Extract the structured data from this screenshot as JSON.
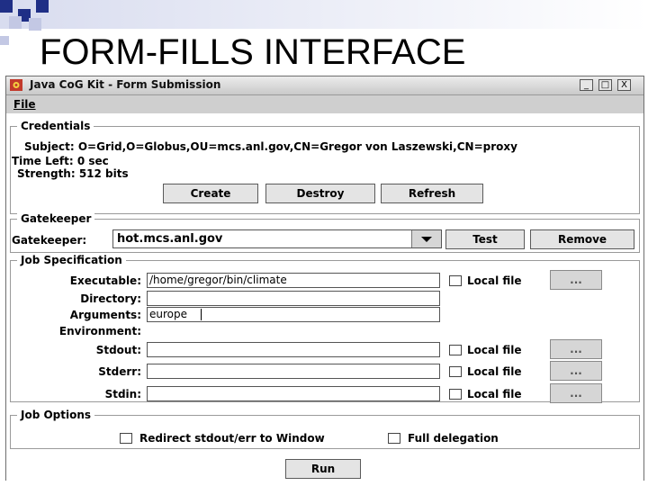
{
  "slide": {
    "title": "FORM-FILLS INTERFACE"
  },
  "window": {
    "title": "Java CoG Kit - Form Submission",
    "menu": {
      "file": "File"
    },
    "controls": {
      "minimize": "_",
      "maximize": "□",
      "close": "X"
    }
  },
  "credentials": {
    "legend": "Credentials",
    "subject": "Subject: O=Grid,O=Globus,OU=mcs.anl.gov,CN=Gregor von Laszewski,CN=proxy",
    "time_left": "Time Left: 0 sec",
    "strength": "Strength: 512 bits",
    "buttons": {
      "create": "Create",
      "destroy": "Destroy",
      "refresh": "Refresh"
    }
  },
  "gatekeeper": {
    "legend": "Gatekeeper",
    "label": "Gatekeeper:",
    "value": "hot.mcs.anl.gov",
    "buttons": {
      "test": "Test",
      "remove": "Remove"
    }
  },
  "job_spec": {
    "legend": "Job Specification",
    "executable": {
      "label": "Executable:",
      "value": "/home/gregor/bin/climate"
    },
    "directory": {
      "label": "Directory:",
      "value": ""
    },
    "arguments": {
      "label": "Arguments:",
      "value": "europe"
    },
    "environment": {
      "label": "Environment:"
    },
    "stdout": {
      "label": "Stdout:",
      "value": ""
    },
    "stderr": {
      "label": "Stderr:",
      "value": ""
    },
    "stdin": {
      "label": "Stdin:",
      "value": ""
    },
    "local_file": "Local file",
    "browse": "..."
  },
  "job_options": {
    "legend": "Job Options",
    "redirect": "Redirect stdout/err to Window",
    "full_delegation": "Full delegation"
  },
  "run_button": "Run"
}
